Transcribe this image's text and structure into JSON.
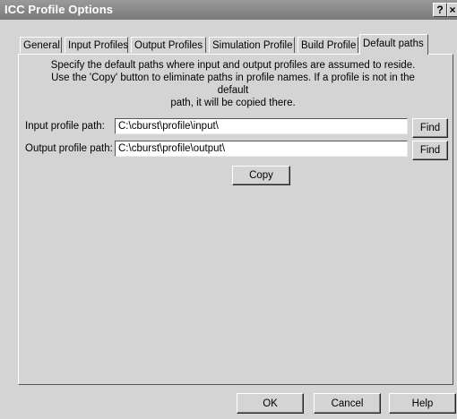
{
  "window": {
    "title": "ICC Profile Options",
    "help_glyph": "?",
    "close_glyph": "×"
  },
  "tabs": [
    {
      "label": "General"
    },
    {
      "label": "Input Profiles"
    },
    {
      "label": "Output Profiles"
    },
    {
      "label": "Simulation Profile"
    },
    {
      "label": "Build Profile"
    },
    {
      "label": "Default paths",
      "active": true
    }
  ],
  "description": {
    "line1": "Specify the default paths where input and output profiles are assumed to reside.",
    "line2": "Use the 'Copy' button to eliminate paths in profile names. If a profile is not in the default",
    "line3": "path, it will be copied there."
  },
  "fields": {
    "input_label": "Input profile path:",
    "input_value": "C:\\cburst\\profile\\input\\",
    "output_label": "Output profile path:",
    "output_value": "C:\\cburst\\profile\\output\\",
    "find_label": "Find"
  },
  "buttons": {
    "copy": "Copy",
    "ok": "OK",
    "cancel": "Cancel",
    "help": "Help"
  },
  "colors": {
    "titlebar": "#8a8a8a",
    "face": "#d4d4d4"
  }
}
